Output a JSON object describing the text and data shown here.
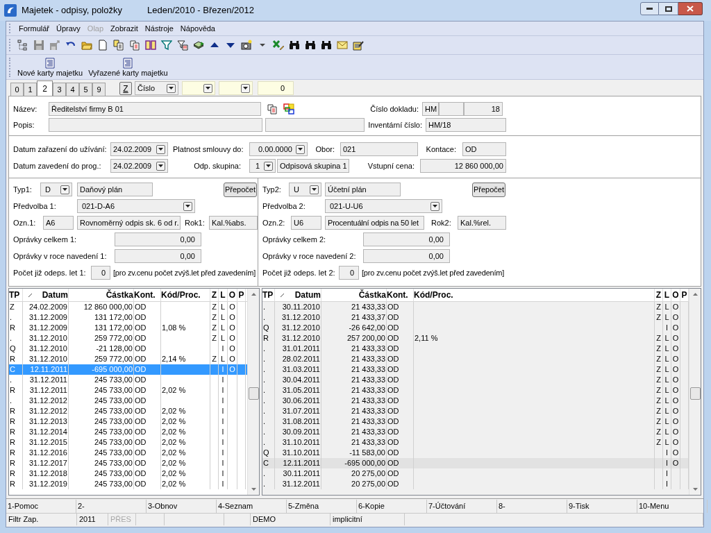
{
  "window": {
    "title": "Majetek - odpisy, položky",
    "period": "Leden/2010 - Březen/2012"
  },
  "menu": [
    {
      "label": "Formulář",
      "disabled": false
    },
    {
      "label": "Úpravy",
      "disabled": false
    },
    {
      "label": "Olap",
      "disabled": true
    },
    {
      "label": "Zobrazit",
      "disabled": false
    },
    {
      "label": "Nástroje",
      "disabled": false
    },
    {
      "label": "Nápověda",
      "disabled": false
    }
  ],
  "action_buttons": [
    "Nové karty majetku",
    "Vyřazené karty majetku"
  ],
  "tabs": [
    {
      "label": "0",
      "selected": false
    },
    {
      "label": "1",
      "selected": false
    },
    {
      "label": "2",
      "selected": true
    },
    {
      "label": "3",
      "selected": false
    },
    {
      "label": "4",
      "selected": false
    },
    {
      "label": "5",
      "selected": false
    },
    {
      "label": "9",
      "selected": false
    }
  ],
  "filter_bar": {
    "z_button": "Z",
    "sort_field": "Číslo",
    "value": "0"
  },
  "header": {
    "name_label": "Název:",
    "name": "Ředitelství firmy B 01",
    "description_label": "Popis:",
    "document_label": "Číslo dokladu:",
    "document_series": "HM",
    "document_number": "18",
    "inventory_label": "Inventární číslo:",
    "inventory_number": "HM/18"
  },
  "dates": {
    "in_use_label": "Datum zařazení do užívání:",
    "in_use": "24.02.2009",
    "contract_label": "Platnost smlouvy do:",
    "contract": "0.00.0000",
    "field_label": "Obor:",
    "field": "021",
    "account_label": "Kontace:",
    "account": "OD",
    "entered_label": "Datum zavedení do prog.:",
    "entered": "24.02.2009",
    "group_label": "Odp. skupina:",
    "group": "1",
    "group_name": "Odpisová skupina 1",
    "price_label": "Vstupní cena:",
    "price": "12 860 000,00"
  },
  "plans": [
    {
      "type_label": "Typ1:",
      "type": "D",
      "type_name": "Daňový plán",
      "button": "Přepočet",
      "preset_label": "Předvolba 1:",
      "preset": "021-D-A6",
      "code_label": "Ozn.1:",
      "code": "A6",
      "method": "Rovnoměrný odpis sk. 6 od r.",
      "year_label": "Rok1:",
      "year": "Kal.%abs.",
      "total_label": "Oprávky celkem 1:",
      "total": "0,00",
      "initial_label": "Oprávky v roce navedení 1:",
      "initial": "0,00",
      "years_label": "Počet již odeps. let 1:",
      "years": "0",
      "note": "[pro zv.cenu počet zvýš.let před zavedením]"
    },
    {
      "type_label": "Typ2:",
      "type": "U",
      "type_name": "Účetní plán",
      "button": "Přepočet",
      "preset_label": "Předvolba 2:",
      "preset": "021-U-U6",
      "code_label": "Ozn.2:",
      "code": "U6",
      "method": "Procentuální odpis na 50 let",
      "year_label": "Rok2:",
      "year": "Kal.%rel.",
      "total_label": "Oprávky celkem 2:",
      "total": "0,00",
      "initial_label": "Oprávky v roce navedení 2:",
      "initial": "0,00",
      "years_label": "Počet již odeps. let 2:",
      "years": "0",
      "note": "[pro zv.cenu počet zvýš.let před zavedením]"
    }
  ],
  "tables": [
    {
      "focused": true,
      "columns": [
        "TP",
        "Datum",
        "Částka",
        "Kont.",
        "Kód/Proc.",
        "Z",
        "L",
        "O",
        "P"
      ],
      "rows": [
        {
          "tp": "Z",
          "date": "24.02.2009",
          "amount": "12 860 000,00",
          "account": "OD",
          "z": "Z",
          "l": "L",
          "o": "O",
          "selected": false
        },
        {
          "tp": ".",
          "date": "31.12.2009",
          "amount": "131 172,00",
          "account": "OD",
          "z": "Z",
          "l": "L",
          "o": "O",
          "selected": false
        },
        {
          "tp": "R",
          "date": "31.12.2009",
          "amount": "131 172,00",
          "account": "OD",
          "code": "1,08 %",
          "z": "Z",
          "l": "L",
          "o": "O",
          "selected": false
        },
        {
          "tp": ".",
          "date": "31.12.2010",
          "amount": "259 772,00",
          "account": "OD",
          "z": "Z",
          "l": "L",
          "o": "O",
          "selected": false
        },
        {
          "tp": "Q",
          "date": "31.12.2010",
          "amount": "-21 128,00",
          "account": "OD",
          "l": "l",
          "o": "O",
          "selected": false
        },
        {
          "tp": "R",
          "date": "31.12.2010",
          "amount": "259 772,00",
          "account": "OD",
          "code": "2,14 %",
          "z": "Z",
          "l": "L",
          "o": "O",
          "selected": false
        },
        {
          "tp": "C",
          "date": "12.11.2011",
          "amount": "-695 000,00",
          "account": "OD",
          "l": "l",
          "o": "O",
          "selected": true
        },
        {
          "tp": ".",
          "date": "31.12.2011",
          "amount": "245 733,00",
          "account": "OD",
          "l": "l",
          "selected": false
        },
        {
          "tp": "R",
          "date": "31.12.2011",
          "amount": "245 733,00",
          "account": "OD",
          "code": "2,02 %",
          "l": "l",
          "selected": false
        },
        {
          "tp": ".",
          "date": "31.12.2012",
          "amount": "245 733,00",
          "account": "OD",
          "l": "l",
          "selected": false
        },
        {
          "tp": "R",
          "date": "31.12.2012",
          "amount": "245 733,00",
          "account": "OD",
          "code": "2,02 %",
          "l": "l",
          "selected": false
        },
        {
          "tp": "R",
          "date": "31.12.2013",
          "amount": "245 733,00",
          "account": "OD",
          "code": "2,02 %",
          "l": "l",
          "selected": false
        },
        {
          "tp": "R",
          "date": "31.12.2014",
          "amount": "245 733,00",
          "account": "OD",
          "code": "2,02 %",
          "l": "l",
          "selected": false
        },
        {
          "tp": "R",
          "date": "31.12.2015",
          "amount": "245 733,00",
          "account": "OD",
          "code": "2,02 %",
          "l": "l",
          "selected": false
        },
        {
          "tp": "R",
          "date": "31.12.2016",
          "amount": "245 733,00",
          "account": "OD",
          "code": "2,02 %",
          "l": "l",
          "selected": false
        },
        {
          "tp": "R",
          "date": "31.12.2017",
          "amount": "245 733,00",
          "account": "OD",
          "code": "2,02 %",
          "l": "l",
          "selected": false
        },
        {
          "tp": "R",
          "date": "31.12.2018",
          "amount": "245 733,00",
          "account": "OD",
          "code": "2,02 %",
          "l": "l",
          "selected": false
        },
        {
          "tp": "R",
          "date": "31.12.2019",
          "amount": "245 733,00",
          "account": "OD",
          "code": "2,02 %",
          "l": "l",
          "selected": false
        }
      ]
    },
    {
      "focused": false,
      "columns": [
        "TP",
        "Datum",
        "Částka",
        "Kont.",
        "Kód/Proc.",
        "Z",
        "L",
        "O",
        "P"
      ],
      "rows": [
        {
          "tp": ".",
          "date": "30.11.2010",
          "amount": "21 433,33",
          "account": "OD",
          "z": "Z",
          "l": "L",
          "o": "O",
          "selected": false
        },
        {
          "tp": ".",
          "date": "31.12.2010",
          "amount": "21 433,37",
          "account": "OD",
          "z": "Z",
          "l": "L",
          "o": "O",
          "selected": false
        },
        {
          "tp": "Q",
          "date": "31.12.2010",
          "amount": "-26 642,00",
          "account": "OD",
          "l": "l",
          "o": "O",
          "selected": false
        },
        {
          "tp": "R",
          "date": "31.12.2010",
          "amount": "257 200,00",
          "account": "OD",
          "code": "2,11 %",
          "z": "Z",
          "l": "L",
          "o": "O",
          "selected": false
        },
        {
          "tp": ".",
          "date": "31.01.2011",
          "amount": "21 433,33",
          "account": "OD",
          "z": "Z",
          "l": "L",
          "o": "O",
          "selected": false
        },
        {
          "tp": ".",
          "date": "28.02.2011",
          "amount": "21 433,33",
          "account": "OD",
          "z": "Z",
          "l": "L",
          "o": "O",
          "selected": false
        },
        {
          "tp": ".",
          "date": "31.03.2011",
          "amount": "21 433,33",
          "account": "OD",
          "z": "Z",
          "l": "L",
          "o": "O",
          "selected": false
        },
        {
          "tp": ".",
          "date": "30.04.2011",
          "amount": "21 433,33",
          "account": "OD",
          "z": "Z",
          "l": "L",
          "o": "O",
          "selected": false
        },
        {
          "tp": ".",
          "date": "31.05.2011",
          "amount": "21 433,33",
          "account": "OD",
          "z": "Z",
          "l": "L",
          "o": "O",
          "selected": false
        },
        {
          "tp": ".",
          "date": "30.06.2011",
          "amount": "21 433,33",
          "account": "OD",
          "z": "Z",
          "l": "L",
          "o": "O",
          "selected": false
        },
        {
          "tp": ".",
          "date": "31.07.2011",
          "amount": "21 433,33",
          "account": "OD",
          "z": "Z",
          "l": "L",
          "o": "O",
          "selected": false
        },
        {
          "tp": ".",
          "date": "31.08.2011",
          "amount": "21 433,33",
          "account": "OD",
          "z": "Z",
          "l": "L",
          "o": "O",
          "selected": false
        },
        {
          "tp": ".",
          "date": "30.09.2011",
          "amount": "21 433,33",
          "account": "OD",
          "z": "Z",
          "l": "L",
          "o": "O",
          "selected": false
        },
        {
          "tp": ".",
          "date": "31.10.2011",
          "amount": "21 433,33",
          "account": "OD",
          "z": "Z",
          "l": "L",
          "o": "O",
          "selected": false
        },
        {
          "tp": "Q",
          "date": "31.10.2011",
          "amount": "-11 583,00",
          "account": "OD",
          "l": "l",
          "o": "O",
          "selected": false
        },
        {
          "tp": "C",
          "date": "12.11.2011",
          "amount": "-695 000,00",
          "account": "OD",
          "l": "l",
          "o": "O",
          "selected": true
        },
        {
          "tp": ".",
          "date": "30.11.2011",
          "amount": "20 275,00",
          "account": "OD",
          "l": "l",
          "selected": false
        },
        {
          "tp": ".",
          "date": "31.12.2011",
          "amount": "20 275,00",
          "account": "OD",
          "l": "l",
          "selected": false
        }
      ]
    }
  ],
  "function_keys": [
    "1-Pomoc",
    "2-",
    "3-Obnov",
    "4-Seznam",
    "5-Změna",
    "6-Kopie",
    "7-Účtování",
    "8-",
    "9-Tisk",
    "10-Menu"
  ],
  "status_bar": [
    {
      "text": "Filtr Zap.",
      "disabled": false
    },
    {
      "text": "2011",
      "disabled": false
    },
    {
      "text": "PŘES",
      "disabled": true
    },
    {
      "text": "DEMO",
      "disabled": false
    },
    {
      "text": "implicitní",
      "disabled": false
    }
  ]
}
